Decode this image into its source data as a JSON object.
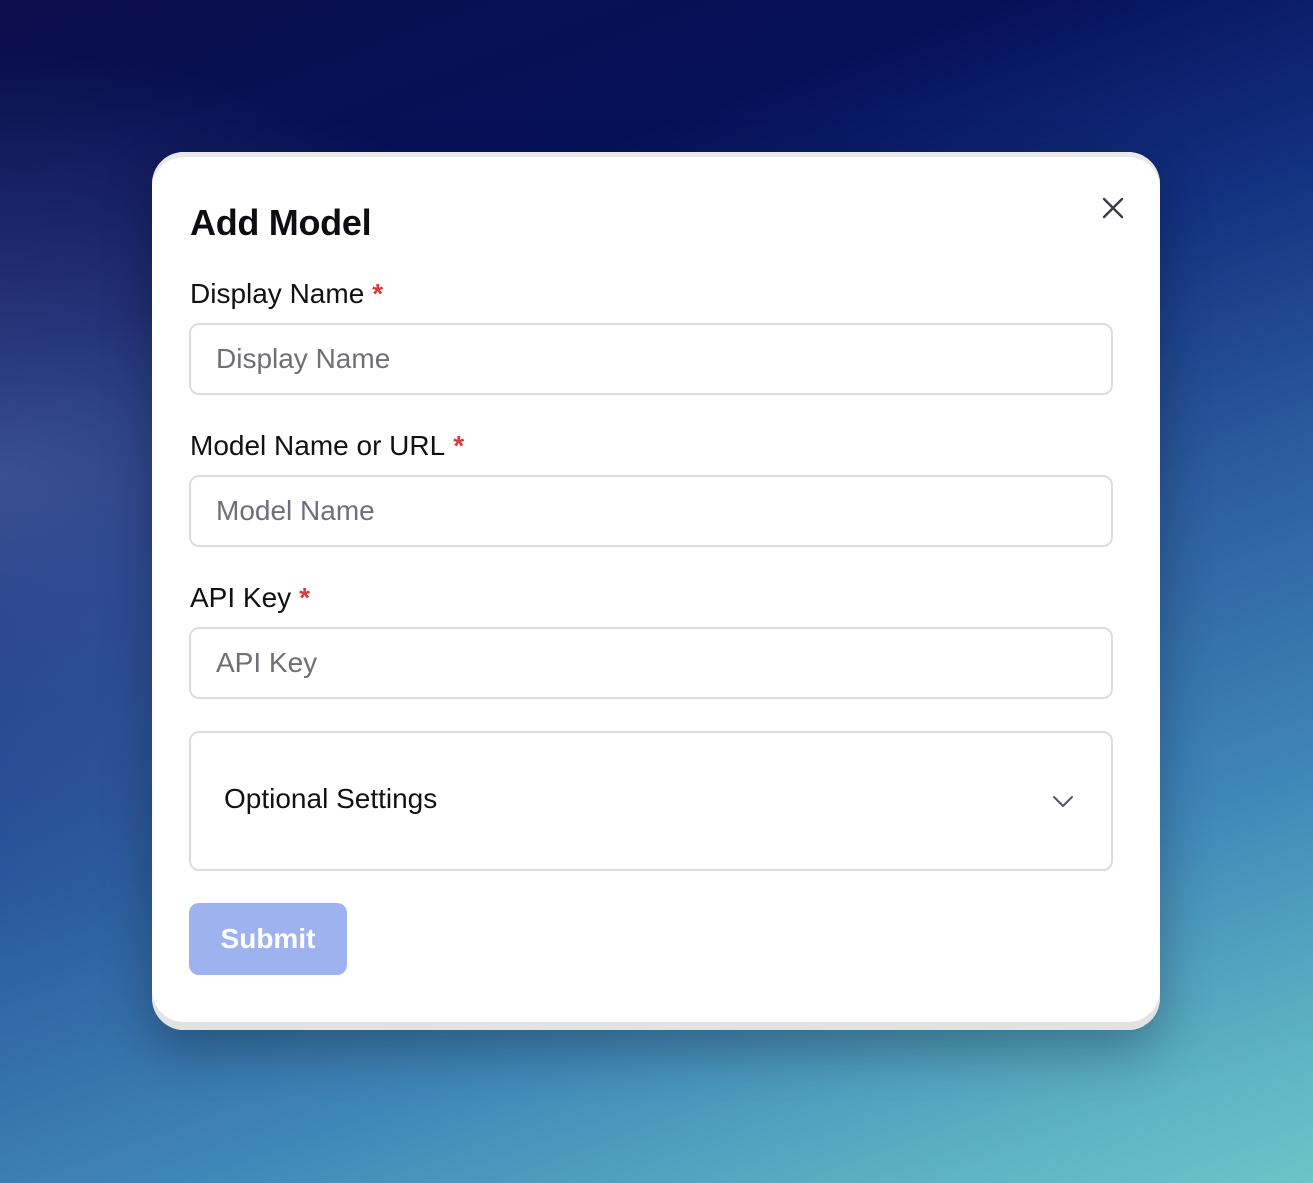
{
  "modal": {
    "title": "Add Model",
    "close_icon": "close-icon"
  },
  "fields": [
    {
      "label": "Display Name",
      "required_mark": "*",
      "placeholder": "Display Name",
      "value": ""
    },
    {
      "label": "Model Name or URL",
      "required_mark": "*",
      "placeholder": "Model Name",
      "value": ""
    },
    {
      "label": "API Key",
      "required_mark": "*",
      "placeholder": "API Key",
      "value": ""
    }
  ],
  "optional_settings": {
    "label": "Optional Settings",
    "expanded": false,
    "icon": "chevron-down-icon"
  },
  "submit": {
    "label": "Submit",
    "enabled": false
  },
  "colors": {
    "required": "#dc3b3b",
    "submit_disabled_bg": "#9db2ef"
  }
}
